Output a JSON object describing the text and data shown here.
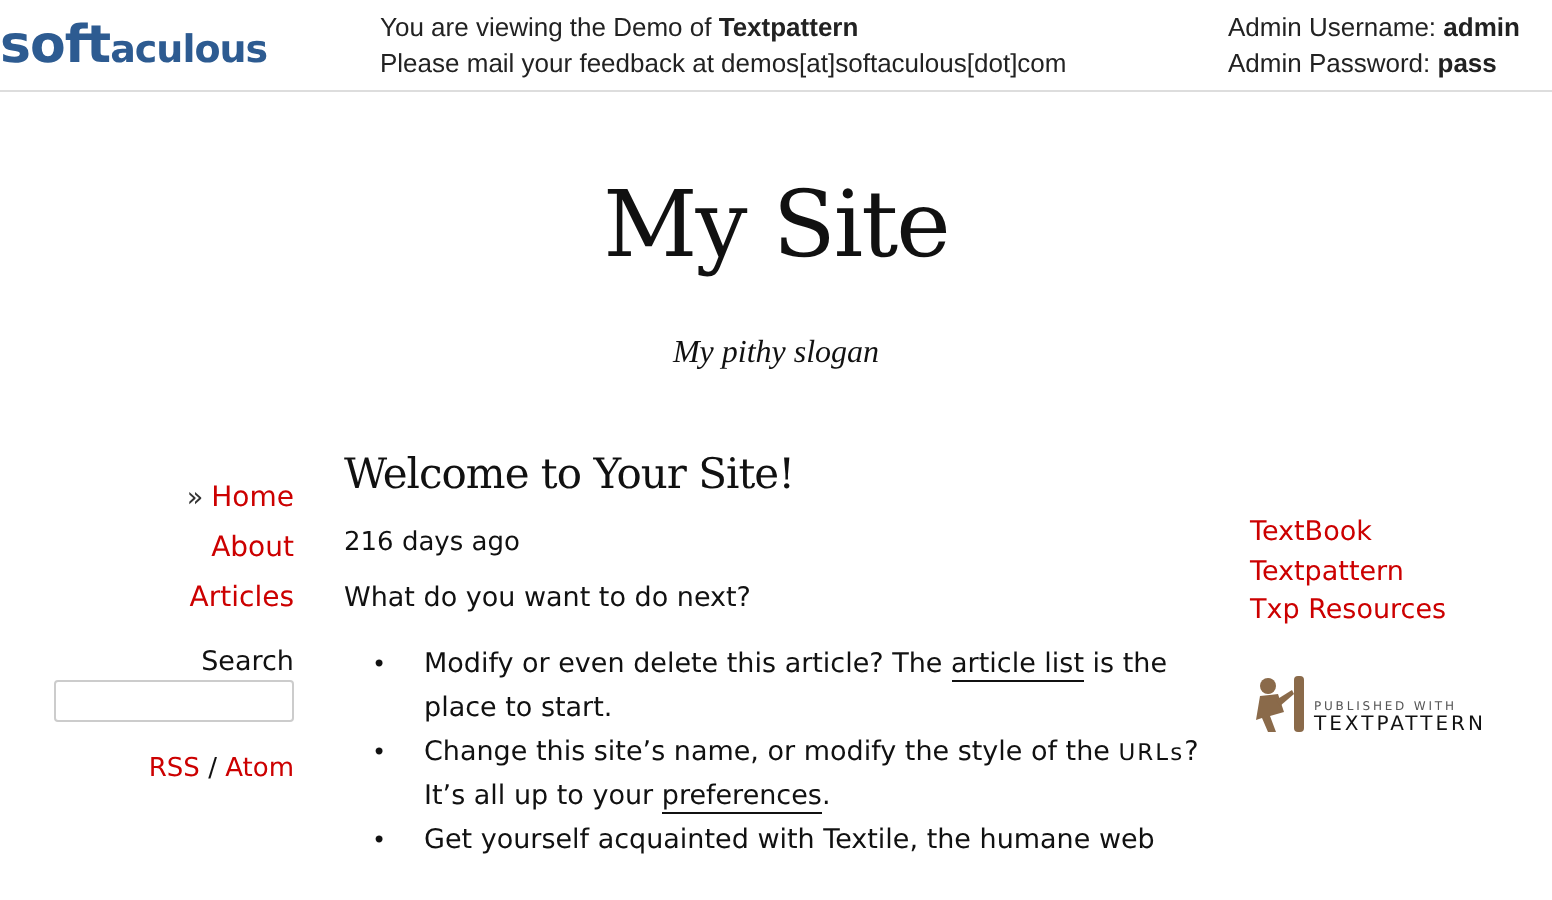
{
  "header": {
    "logo": {
      "big": "soft",
      "small": "aculous"
    },
    "notice": [
      {
        "text": "You are viewing the Demo of ",
        "strong": "Textpattern"
      },
      {
        "text": "Please mail your feedback at demos[at]softaculous[dot]com"
      }
    ],
    "credentials": [
      {
        "label": "Admin Username: ",
        "value": "admin"
      },
      {
        "label": "Admin Password: ",
        "value": "pass"
      }
    ]
  },
  "site": {
    "title": "My Site",
    "slogan": "My pithy slogan"
  },
  "nav": {
    "marker": "»",
    "items": [
      {
        "label": "Home",
        "selected": true
      },
      {
        "label": "About",
        "selected": false
      },
      {
        "label": "Articles",
        "selected": false
      }
    ],
    "search_label": "Search",
    "feeds": [
      {
        "label": "RSS"
      },
      {
        "label": "Atom"
      }
    ],
    "feed_separator": "/"
  },
  "article": {
    "title": "Welcome to Your Site!",
    "date": "216 days ago",
    "intro": "What do you want to do next?",
    "marker": "•",
    "bullets": [
      {
        "parts": [
          {
            "kind": "text",
            "text": "Modify or even delete this article? The "
          },
          {
            "kind": "link",
            "text": "article list"
          },
          {
            "kind": "text",
            "text": " is the place to start."
          }
        ]
      },
      {
        "parts": [
          {
            "kind": "text",
            "text": "Change this site’s name, or modify the style of the "
          },
          {
            "kind": "acronym",
            "text": "URLs"
          },
          {
            "kind": "text",
            "text": "? It’s all up to your "
          },
          {
            "kind": "link",
            "text": "preferences"
          },
          {
            "kind": "text",
            "text": "."
          }
        ]
      },
      {
        "parts": [
          {
            "kind": "text",
            "text": "Get yourself acquainted with Textile, the humane web"
          }
        ]
      }
    ]
  },
  "links": [
    {
      "label": "TextBook"
    },
    {
      "label": "Textpattern"
    },
    {
      "label": "Txp Resources"
    }
  ],
  "badge": {
    "caption": "PUBLISHED WITH",
    "name": "TEXTPATTERN"
  }
}
